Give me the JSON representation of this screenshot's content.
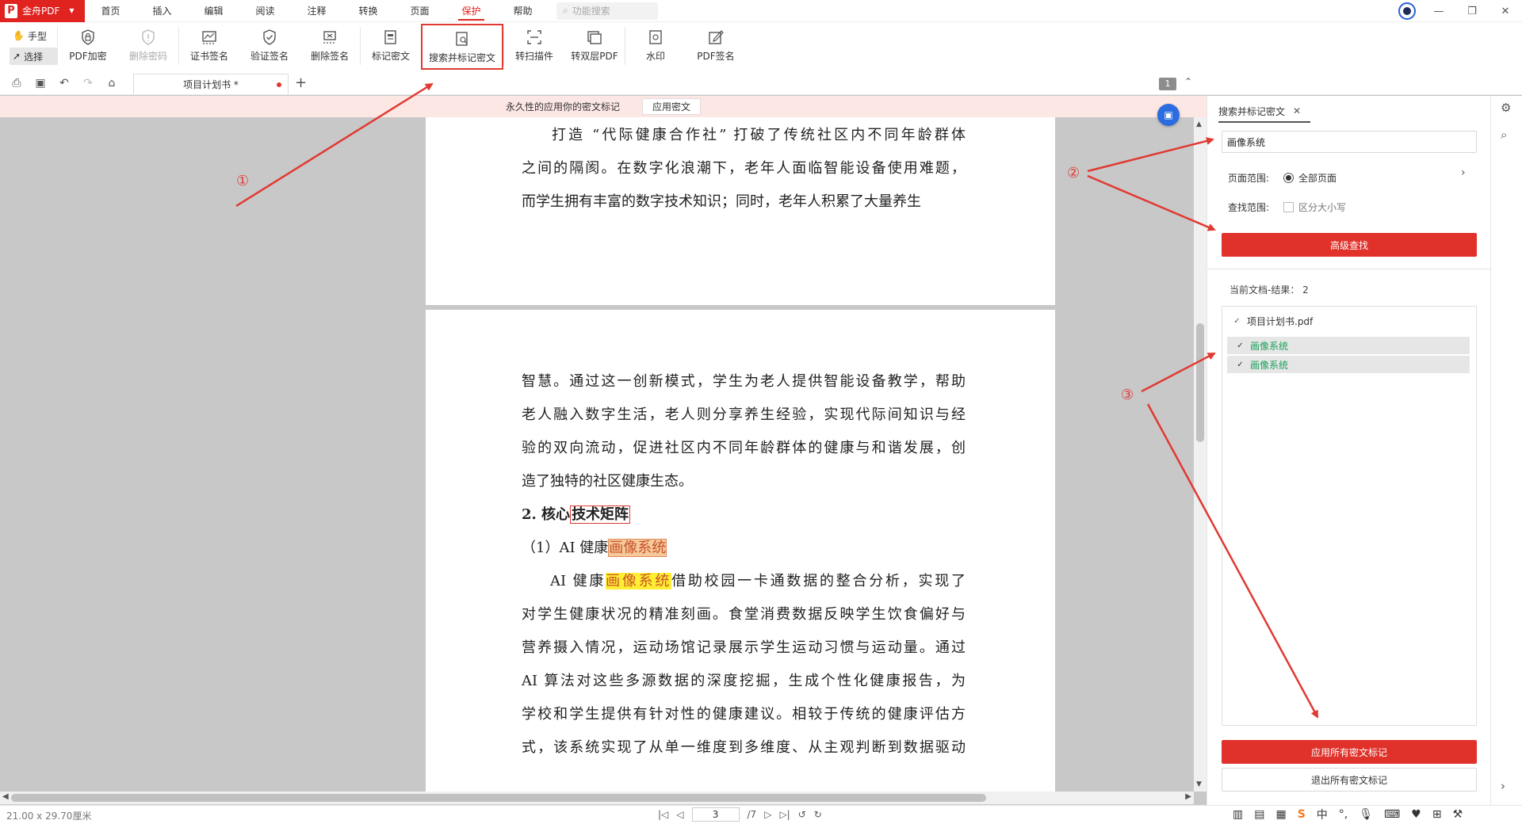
{
  "app": {
    "name": "金舟PDF",
    "menus": [
      "首页",
      "插入",
      "编辑",
      "阅读",
      "注释",
      "转换",
      "页面",
      "保护",
      "帮助"
    ],
    "active_menu": "保护",
    "search_placeholder": "功能搜索"
  },
  "toolbar": {
    "modes": [
      "手型",
      "选择"
    ],
    "tools": [
      {
        "label": "PDF加密",
        "icon": "shield-lock-icon"
      },
      {
        "label": "删除密码",
        "icon": "shield-remove-icon"
      },
      {
        "label": "证书签名",
        "icon": "certificate-sign-icon"
      },
      {
        "label": "验证签名",
        "icon": "verify-sign-icon"
      },
      {
        "label": "删除签名",
        "icon": "delete-sign-icon"
      },
      {
        "label": "标记密文",
        "icon": "mark-redact-icon"
      },
      {
        "label": "搜索并标记密文",
        "icon": "search-redact-icon"
      },
      {
        "label": "转扫描件",
        "icon": "scan-icon"
      },
      {
        "label": "转双层PDF",
        "icon": "double-layer-icon"
      },
      {
        "label": "水印",
        "icon": "watermark-icon"
      },
      {
        "label": "PDF签名",
        "icon": "pdf-sign-icon"
      }
    ]
  },
  "tabs": {
    "doc_tab": "项目计划书 *",
    "page_badge": "1"
  },
  "notice": {
    "text": "永久性的应用你的密文标记",
    "button": "应用密文"
  },
  "document": {
    "top_page_lines": [
      "打造 “代际健康合作社” 打破了传统社区内不同年龄群体",
      "之间的隔阂。在数字化浪潮下，老年人面临智能设备使用难题，",
      "而学生拥有丰富的数字技术知识；同时，老年人积累了大量养生"
    ],
    "para1": [
      "智慧。通过这一创新模式，学生为老人提供智能设备教学，帮助",
      "老人融入数字生活，老人则分享养生经验，实现代际间知识与经",
      "验的双向流动，促进社区内不同年龄群体的健康与和谐发展，创",
      "造了独特的社区健康生态。"
    ],
    "heading": {
      "prefix": "2. 核心",
      "boxed": "技术矩阵"
    },
    "subheading": {
      "prefix": "（1）AI 健康",
      "highlight": "画像系统"
    },
    "para2_first": {
      "prefix": "AI 健康",
      "highlight": "画像系统",
      "suffix": "借助校园一卡通数据的整合分析，实现了"
    },
    "para2": [
      "对学生健康状况的精准刻画。食堂消费数据反映学生饮食偏好与",
      "营养摄入情况，运动场馆记录展示学生运动习惯与运动量。通过",
      "AI 算法对这些多源数据的深度挖掘，生成个性化健康报告，为",
      "学校和学生提供有针对性的健康建议。相较于传统的健康评估方",
      "式，该系统实现了从单一维度到多维度、从主观判断到数据驱动"
    ]
  },
  "panel": {
    "tab_title": "搜索并标记密文",
    "search_value": "画像系统",
    "page_range_label": "页面范围:",
    "page_range_value": "全部页面",
    "find_range_label": "查找范围:",
    "case_label": "区分大小写",
    "advanced_button": "高级查找",
    "result_label": "当前文档-结果：",
    "result_count": "2",
    "file_name": "项目计划书.pdf",
    "results": [
      "画像系统",
      "画像系统"
    ],
    "apply_all_button": "应用所有密文标记",
    "exit_all_button": "退出所有密文标记"
  },
  "status": {
    "dimensions": "21.00 x 29.70厘米",
    "current_page": "3",
    "total_pages": "/7"
  },
  "annotations": [
    "①",
    "②",
    "③"
  ],
  "colors": {
    "accent": "#e0231f",
    "result_green": "#1aa15b",
    "highlight_yellow": "#ffee33"
  }
}
